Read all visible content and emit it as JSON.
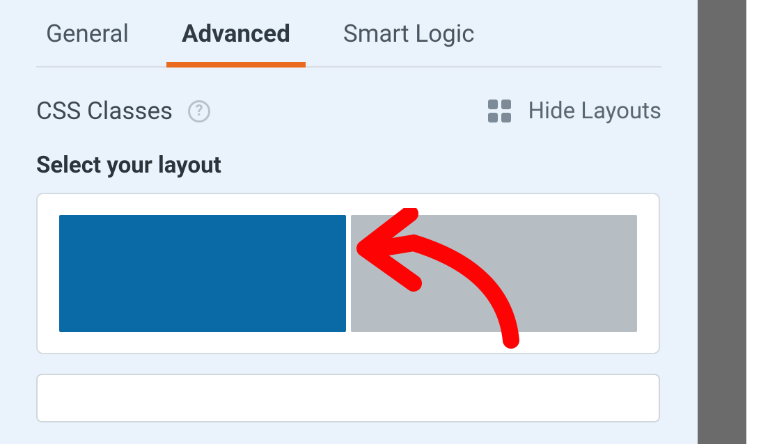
{
  "tabs": {
    "general": "General",
    "advanced": "Advanced",
    "smart_logic": "Smart Logic"
  },
  "section": {
    "label": "CSS Classes",
    "help": "?",
    "hide_layouts": "Hide Layouts"
  },
  "subheading": "Select your layout",
  "colors": {
    "accent": "#ea6a20",
    "selected_block": "#0a6aa6",
    "unselected_block": "#b6bdc3",
    "annotation": "#fd0303"
  }
}
